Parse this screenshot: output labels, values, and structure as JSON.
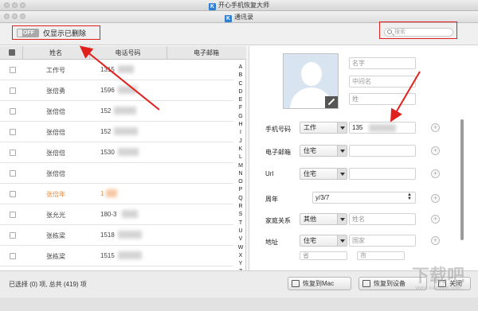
{
  "app": {
    "window_title": "开心手机恢复大师",
    "app_icon_letter": "K",
    "inner_title": "通讯录"
  },
  "toolbar": {
    "toggle_state": "OFF",
    "toggle_label": "仅显示已删除",
    "search_placeholder": "搜索"
  },
  "table": {
    "headers": {
      "name": "姓名",
      "phone": "电话号码",
      "email": "电子邮箱"
    },
    "rows": [
      {
        "name": "工作号",
        "phone": "1315",
        "highlight": false
      },
      {
        "name": "张倍勇",
        "phone": "1596",
        "highlight": false
      },
      {
        "name": "张倍倍",
        "phone": "152",
        "highlight": false
      },
      {
        "name": "张倍倍",
        "phone": "152",
        "highlight": false
      },
      {
        "name": "张倍倍",
        "phone": "1530",
        "highlight": false
      },
      {
        "name": "张倍倍",
        "phone": "",
        "highlight": false
      },
      {
        "name": "张倍年",
        "phone": "1",
        "highlight": true
      },
      {
        "name": "张允光",
        "phone": "180-3",
        "highlight": false
      },
      {
        "name": "张栋梁",
        "phone": "1518",
        "highlight": false
      },
      {
        "name": "张栋梁",
        "phone": "1515",
        "highlight": false
      }
    ],
    "alpha_index": [
      "A",
      "B",
      "C",
      "D",
      "E",
      "F",
      "G",
      "H",
      "I",
      "J",
      "K",
      "L",
      "M",
      "N",
      "O",
      "P",
      "Q",
      "R",
      "S",
      "T",
      "U",
      "V",
      "W",
      "X",
      "Y",
      "Z",
      "#"
    ]
  },
  "detail": {
    "name_placeholders": {
      "first": "名字",
      "middle": "中间名",
      "last": "姓"
    },
    "fields": {
      "phone": {
        "label": "手机号码",
        "type": "工作",
        "value": "135"
      },
      "email": {
        "label": "电子邮箱",
        "type": "住宅",
        "value": ""
      },
      "url": {
        "label": "Url",
        "type": "住宅",
        "value": ""
      },
      "anniversary": {
        "label": "周年",
        "value": "y/3/7"
      },
      "relation": {
        "label": "家庭关系",
        "type": "其他",
        "placeholder": "姓名"
      },
      "address": {
        "label": "地址",
        "type": "住宅",
        "country_placeholder": "国家",
        "province_placeholder": "省",
        "city_placeholder": "市"
      }
    }
  },
  "footer": {
    "status": "已选择 (0) 项, 总共 (419) 项",
    "restore_mac": "恢复到Mac",
    "restore_device": "恢复到设备",
    "close": "关闭"
  },
  "watermark": {
    "main": "下载吧",
    "sub": "www.xiazaiba.com"
  },
  "colors": {
    "annotation_red": "#e0201c",
    "highlight_orange": "#e8904a",
    "brand_blue": "#2d7fd1"
  }
}
